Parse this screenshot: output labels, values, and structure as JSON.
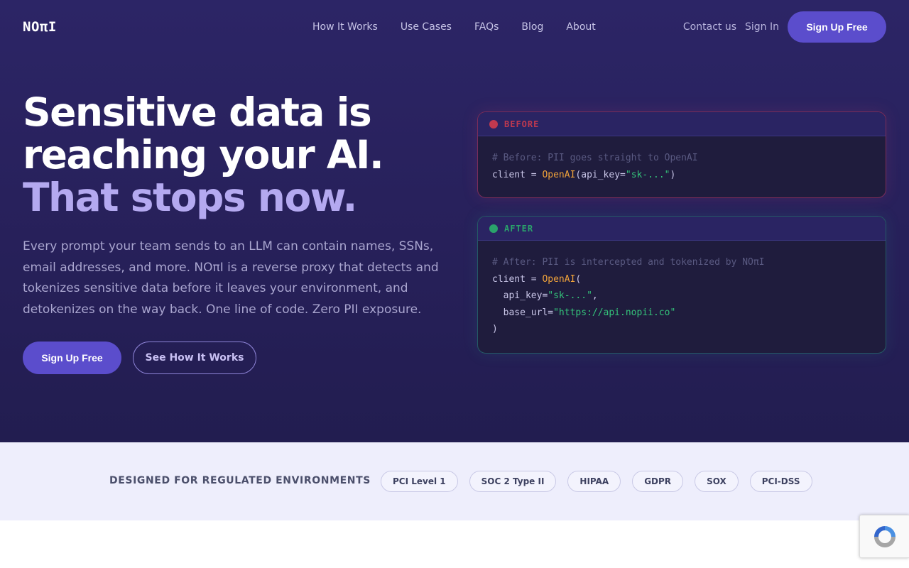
{
  "brand": {
    "logo": "NOπI"
  },
  "nav": {
    "links": [
      "How It Works",
      "Use Cases",
      "FAQs",
      "Blog",
      "About"
    ],
    "contact": "Contact us",
    "sign_in": "Sign In",
    "sign_up": "Sign Up Free"
  },
  "hero": {
    "headline_line1": "Sensitive data is",
    "headline_line2": "reaching your AI.",
    "headline_line3": "That stops now.",
    "lead": "Every prompt your team sends to an LLM can contain names, SSNs, email addresses, and more. NOπI is a reverse proxy that detects and tokenizes sensitive data before it leaves your environment, and detokenizes on the way back. One line of code. Zero PII exposure.",
    "cta_primary": "Sign Up Free",
    "cta_secondary": "See How It Works"
  },
  "code_before": {
    "label": "BEFORE",
    "comment": "# Before: PII goes straight to OpenAI",
    "line_prefix": "client = ",
    "fn": "OpenAI",
    "args_open": "(api_key=",
    "key": "\"sk-...\"",
    "args_close": ")"
  },
  "code_after": {
    "label": "AFTER",
    "comment": "# After: PII is intercepted and tokenized by NOπI",
    "line_prefix": "client = ",
    "fn": "OpenAI",
    "open_paren": "(",
    "api_key_label": "  api_key=",
    "key": "\"sk-...\"",
    "comma": ",",
    "base_url_label": "  base_url=",
    "base_url": "\"https://api.nopii.co\"",
    "close_paren": ")"
  },
  "compliance": {
    "label": "DESIGNED FOR REGULATED ENVIRONMENTS",
    "badges": [
      "PCI Level 1",
      "SOC 2 Type II",
      "HIPAA",
      "GDPR",
      "SOX",
      "PCI-DSS"
    ]
  },
  "colors": {
    "hero_bg": "#28215c",
    "accent": "#5b4dcc",
    "headline_accent": "#b4a9f0",
    "before": "#c0394f",
    "after": "#2aa36b"
  },
  "icons": {
    "recaptcha": "recaptcha-icon"
  }
}
